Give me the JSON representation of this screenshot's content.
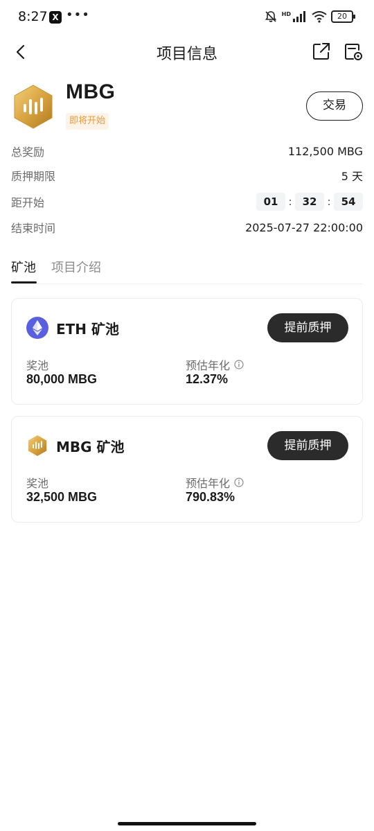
{
  "status_bar": {
    "time": "8:27",
    "x_app": "X",
    "dots": "•••",
    "hd": "HD",
    "battery": "20"
  },
  "nav": {
    "title": "项目信息"
  },
  "token": {
    "name": "MBG",
    "status": "即将开始",
    "trade_label": "交易"
  },
  "info": {
    "total_reward_label": "总奖励",
    "total_reward_value": "112,500 MBG",
    "stake_period_label": "质押期限",
    "stake_period_value": "5 天",
    "countdown_label": "距开始",
    "countdown": {
      "hours": "01",
      "minutes": "32",
      "seconds": "54",
      "sep": ":"
    },
    "end_time_label": "结束时间",
    "end_time_value": "2025-07-27 22:00:00"
  },
  "tabs": [
    {
      "label": "矿池",
      "active": true
    },
    {
      "label": "项目介绍",
      "active": false
    }
  ],
  "pools": [
    {
      "name": "ETH 矿池",
      "icon": "ethereum-icon",
      "button": "提前质押",
      "pool_label": "奖池",
      "pool_value": "80,000 MBG",
      "apr_label": "预估年化",
      "apr_value": "12.37%"
    },
    {
      "name": "MBG 矿池",
      "icon": "mbg-token-icon",
      "button": "提前质押",
      "pool_label": "奖池",
      "pool_value": "32,500 MBG",
      "apr_label": "预估年化",
      "apr_value": "790.83%"
    }
  ],
  "colors": {
    "badge_bg": "#fdf3e6",
    "badge_text": "#ec9a3c",
    "button_dark": "#2b2b2b",
    "eth_blue": "#5a5fe0",
    "gold": "#d9a441"
  }
}
